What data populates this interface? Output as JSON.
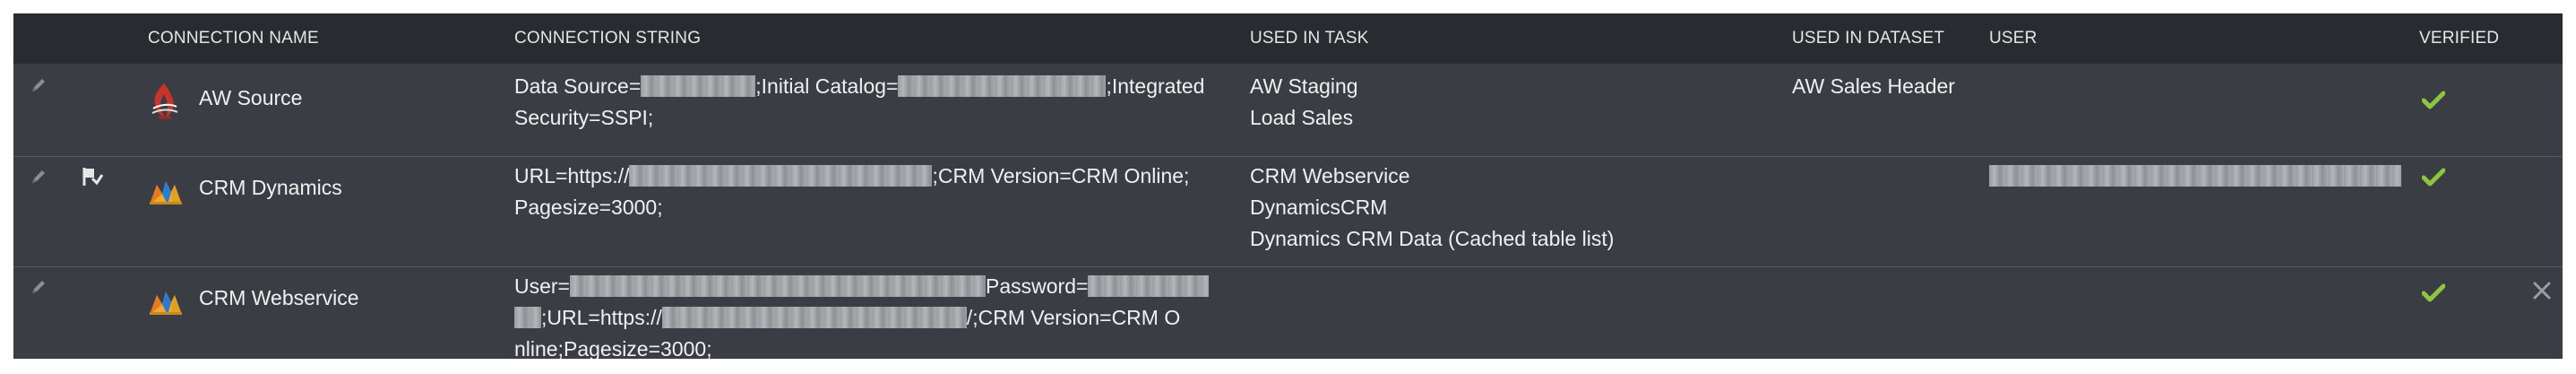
{
  "columns": {
    "connection_name": "CONNECTION NAME",
    "connection_string": "CONNECTION STRING",
    "used_in_task": "USED IN TASK",
    "used_in_dataset": "USED IN DATASET",
    "user": "USER",
    "verified": "VERIFIED"
  },
  "rows": [
    {
      "name": "AW Source",
      "icon": "sql-server-icon",
      "connection_string": {
        "p1": "Data Source=",
        "p2": ";Initial Catalog=",
        "p3": ";Integrated",
        "p4": "Security=SSPI;"
      },
      "tasks": [
        "AW Staging",
        "Load Sales"
      ],
      "dataset": "AW Sales Header",
      "user": "",
      "verified": "✔"
    },
    {
      "name": "CRM Dynamics",
      "icon": "dynamics-crm-icon",
      "connection_string": {
        "p1": "URL=https://",
        "p2": ";CRM Version=CRM Online;",
        "p3": "Pagesize=3000;"
      },
      "tasks": [
        "CRM Webservice",
        "DynamicsCRM",
        "Dynamics CRM Data (Cached table list)"
      ],
      "dataset": "",
      "user": "",
      "verified": "✔"
    },
    {
      "name": "CRM Webservice",
      "icon": "dynamics-crm-icon",
      "connection_string": {
        "p1": "User=",
        "p2": "Password=",
        "p3": ";URL=https://",
        "p4": "/;CRM Version=CRM O",
        "p5": "nline;Pagesize=3000;"
      },
      "tasks": [],
      "dataset": "",
      "user": "",
      "verified": "✔",
      "delete": "×"
    }
  ],
  "colors": {
    "grid_background": "#3a3e44",
    "header_background": "#282b2f",
    "text": "#f0f0f0",
    "verified_green": "#8cc63f"
  }
}
